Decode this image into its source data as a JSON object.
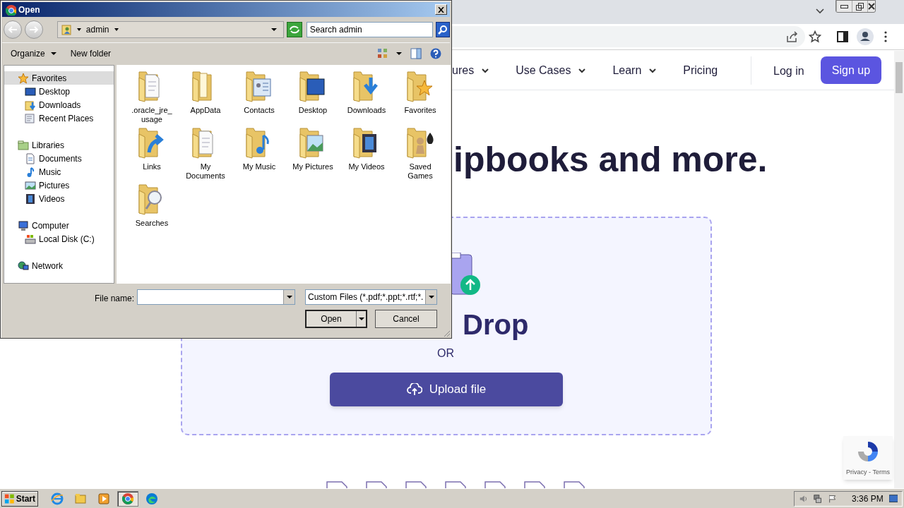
{
  "browser": {
    "nav": [
      {
        "label": "ures",
        "dropdown": true
      },
      {
        "label": "Use Cases",
        "dropdown": true
      },
      {
        "label": "Learn",
        "dropdown": true
      },
      {
        "label": "Pricing",
        "dropdown": false
      }
    ],
    "login": "Log in",
    "signup": "Sign up"
  },
  "page": {
    "headline": "ipbooks and more.",
    "drop_title": "Drop",
    "or": "OR",
    "upload": "Upload file",
    "recaptcha": "Privacy - Terms"
  },
  "dialog": {
    "title": "Open",
    "location": "admin",
    "search": {
      "placeholder": "Search admin"
    },
    "toolbar": [
      "Organize",
      "New folder"
    ],
    "tree": [
      {
        "label": "Favorites",
        "kind": "star",
        "selected": true,
        "children": [
          {
            "label": "Desktop",
            "kind": "desktop",
            "selected": false
          },
          {
            "label": "Downloads",
            "kind": "downloads",
            "selected": false
          },
          {
            "label": "Recent Places",
            "kind": "recent",
            "selected": false
          }
        ]
      },
      {
        "label": "Libraries",
        "kind": "library",
        "selected": false,
        "children": [
          {
            "label": "Documents",
            "kind": "document",
            "selected": false
          },
          {
            "label": "Music",
            "kind": "music",
            "selected": false
          },
          {
            "label": "Pictures",
            "kind": "pictures",
            "selected": false
          },
          {
            "label": "Videos",
            "kind": "videos",
            "selected": false
          }
        ]
      },
      {
        "label": "Computer",
        "kind": "computer",
        "selected": false,
        "children": [
          {
            "label": "Local Disk (C:)",
            "kind": "disk",
            "selected": false
          }
        ]
      },
      {
        "label": "Network",
        "kind": "network",
        "selected": false
      }
    ],
    "files": [
      {
        "name": ".oracle_jre_usage",
        "kind": "page"
      },
      {
        "name": "AppData",
        "kind": "plain"
      },
      {
        "name": "Contacts",
        "kind": "contacts"
      },
      {
        "name": "Desktop",
        "kind": "desktop"
      },
      {
        "name": "Downloads",
        "kind": "downloads"
      },
      {
        "name": "Favorites",
        "kind": "star"
      },
      {
        "name": "Links",
        "kind": "links"
      },
      {
        "name": "My Documents",
        "kind": "page"
      },
      {
        "name": "My Music",
        "kind": "music"
      },
      {
        "name": "My Pictures",
        "kind": "pictures"
      },
      {
        "name": "My Videos",
        "kind": "videos"
      },
      {
        "name": "Saved Games",
        "kind": "games"
      },
      {
        "name": "Searches",
        "kind": "search"
      }
    ],
    "file_name_label": "File name:",
    "filter": "Custom Files (*.pdf;*.ppt;*.rtf;*.",
    "open": "Open",
    "cancel": "Cancel"
  },
  "taskbar": {
    "start": "Start",
    "apps": [
      {
        "kind": "ie",
        "selected": false
      },
      {
        "kind": "explorer",
        "selected": false
      },
      {
        "kind": "media",
        "selected": false
      },
      {
        "kind": "chrome",
        "selected": true
      },
      {
        "kind": "edge",
        "selected": false
      }
    ],
    "clock": "3:36 PM"
  }
}
